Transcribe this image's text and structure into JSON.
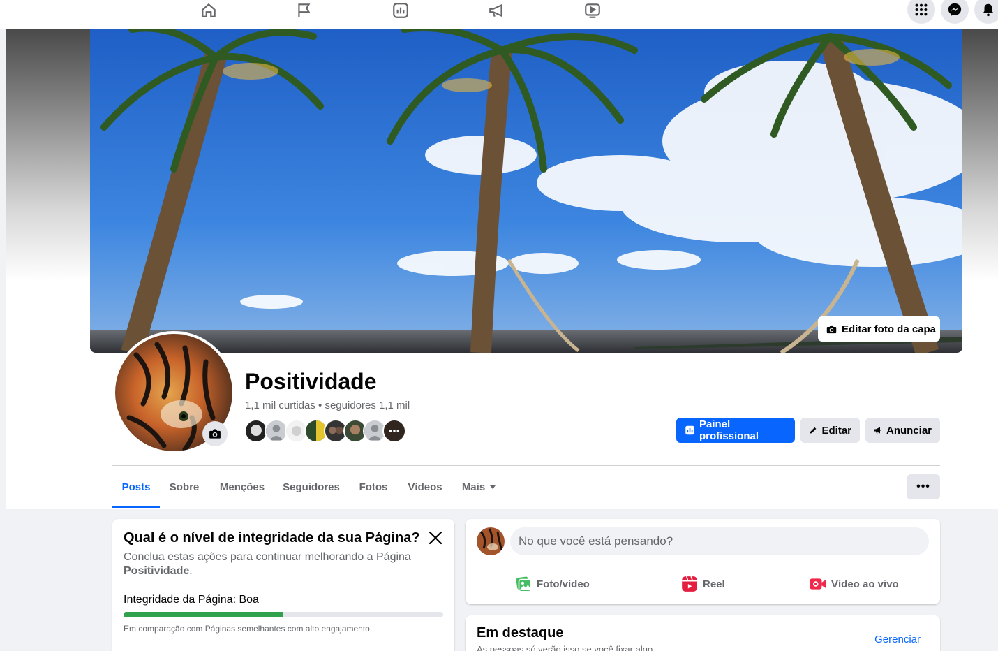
{
  "topnav": {
    "icons": [
      "home-icon",
      "flag-icon",
      "insights-icon",
      "megaphone-icon",
      "video-icon"
    ],
    "right_buttons": [
      "menu-grid-icon",
      "messenger-icon",
      "notifications-icon"
    ]
  },
  "cover": {
    "edit_label": "Editar foto da capa"
  },
  "profile": {
    "name": "Positividade",
    "stats": "1,1 mil curtidas • seguidores 1,1 mil"
  },
  "actions": {
    "dashboard": "Painel profissional",
    "edit": "Editar",
    "advertise": "Anunciar"
  },
  "tabs": [
    "Posts",
    "Sobre",
    "Menções",
    "Seguidores",
    "Fotos",
    "Vídeos",
    "Mais"
  ],
  "health_card": {
    "title": "Qual é o nível de integridade da sua Página?",
    "desc_prefix": "Conclua estas ações para continuar melhorando a Página ",
    "desc_page": "Positividade",
    "desc_suffix": ".",
    "integrity_label": "Integridade da Página: Boa",
    "integrity_progress": 0.5,
    "comparison": "Em comparação com Páginas semelhantes com alto engajamento."
  },
  "composer": {
    "placeholder": "No que você está pensando?",
    "photo_video": "Foto/vídeo",
    "reel": "Reel",
    "live_video": "Vídeo ao vivo"
  },
  "featured": {
    "title": "Em destaque",
    "subtitle": "As pessoas só verão isso se você fixar algo.",
    "manage": "Gerenciar"
  },
  "colors": {
    "primary": "#0866ff",
    "progress_good": "#31a24c",
    "secondary_text": "#65676b"
  }
}
